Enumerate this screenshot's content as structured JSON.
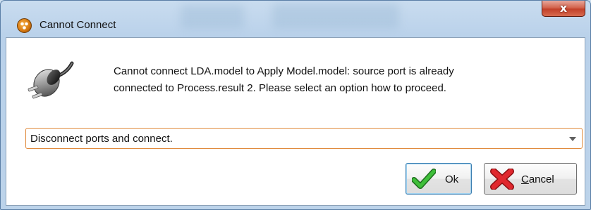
{
  "dialog": {
    "title": "Cannot Connect",
    "close_label": "x",
    "message_line1": "Cannot connect LDA.model to Apply Model.model: source port is already",
    "message_line2": "connected to Process.result 2. Please select an option how to proceed.",
    "icon": "plug-icon"
  },
  "option_select": {
    "selected": "Disconnect ports and connect."
  },
  "buttons": {
    "ok_label": "Ok",
    "cancel_label": "Cancel"
  },
  "colors": {
    "title_bar": "#b9d1ea",
    "close_button": "#c2412a",
    "select_focus_border": "#e08a3c",
    "ok_check": "#3aa53a",
    "cancel_x": "#d8262c"
  }
}
